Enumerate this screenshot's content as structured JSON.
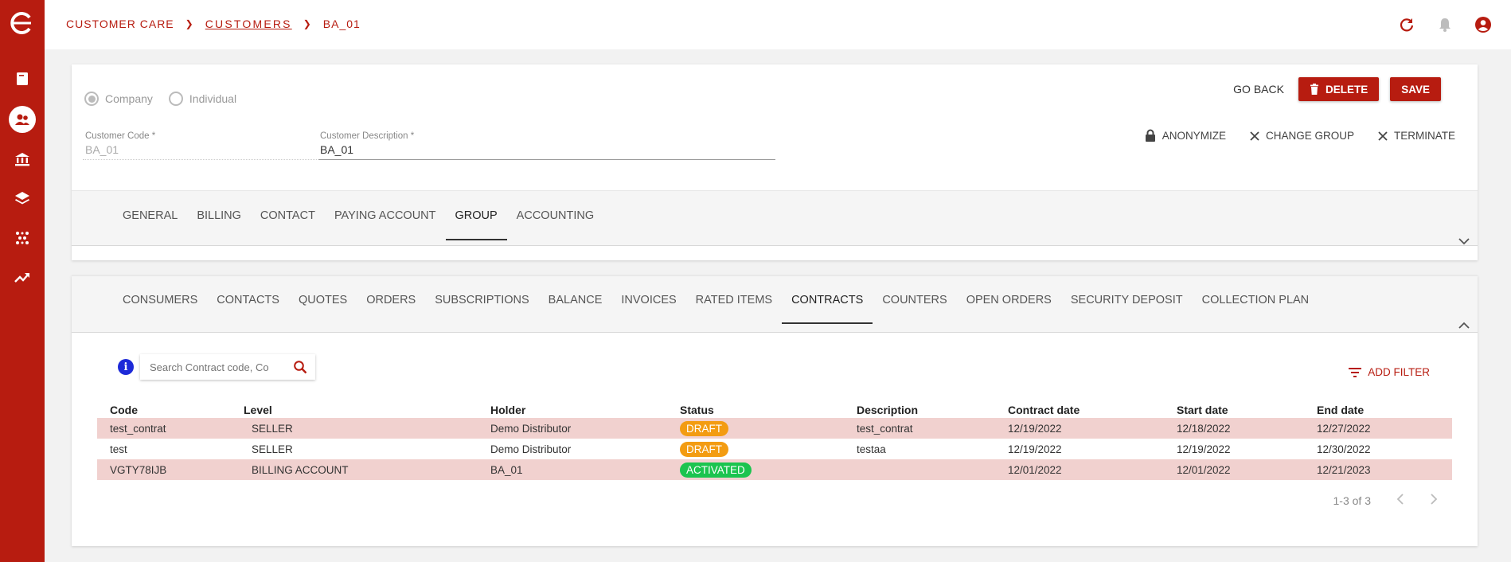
{
  "colors": {
    "accent": "#b71c10",
    "draft": "#f39c12",
    "activated": "#1bc44f",
    "row_highlight": "#f1d1cf"
  },
  "breadcrumb": {
    "root": "CUSTOMER CARE",
    "customers": "CUSTOMERS",
    "current": "BA_01"
  },
  "top_icons": [
    "refresh-icon",
    "bell-icon",
    "account-circle-icon"
  ],
  "sidebar": [
    "logo-icon",
    "book-icon",
    "users-icon",
    "bank-icon",
    "layers-icon",
    "network-icon",
    "trending-up-icon"
  ],
  "customer": {
    "type_company": "Company",
    "type_individual": "Individual",
    "code_label": "Customer Code *",
    "code_value": "BA_01",
    "desc_label": "Customer Description *",
    "desc_value": "BA_01"
  },
  "actions": {
    "go_back": "GO BACK",
    "delete": "DELETE",
    "save": "SAVE",
    "anonymize": "ANONYMIZE",
    "change_group": "CHANGE GROUP",
    "terminate": "TERMINATE"
  },
  "tabs_top": [
    "GENERAL",
    "BILLING",
    "CONTACT",
    "PAYING ACCOUNT",
    "GROUP",
    "ACCOUNTING"
  ],
  "tabs_top_active": "GROUP",
  "tabs_bottom": [
    "CONSUMERS",
    "CONTACTS",
    "QUOTES",
    "ORDERS",
    "SUBSCRIPTIONS",
    "BALANCE",
    "INVOICES",
    "RATED ITEMS",
    "CONTRACTS",
    "COUNTERS",
    "OPEN ORDERS",
    "SECURITY DEPOSIT",
    "COLLECTION PLAN"
  ],
  "tabs_bottom_active": "CONTRACTS",
  "search": {
    "placeholder": "Search Contract code, Co"
  },
  "filter": {
    "add_label": "ADD FILTER"
  },
  "table": {
    "columns": [
      "Code",
      "Level",
      "Holder",
      "Status",
      "Description",
      "Contract date",
      "Start date",
      "End date"
    ],
    "rows": [
      {
        "code": "test_contrat",
        "level": "SELLER",
        "holder": "Demo Distributor",
        "status": "DRAFT",
        "description": "test_contrat",
        "contract_date": "12/19/2022",
        "start_date": "12/18/2022",
        "end_date": "12/27/2022",
        "highlight": true
      },
      {
        "code": "test",
        "level": "SELLER",
        "holder": "Demo Distributor",
        "status": "DRAFT",
        "description": "testaa",
        "contract_date": "12/19/2022",
        "start_date": "12/19/2022",
        "end_date": "12/30/2022",
        "highlight": false
      },
      {
        "code": "VGTY78IJB",
        "level": "BILLING ACCOUNT",
        "holder": "BA_01",
        "status": "ACTIVATED",
        "description": "",
        "contract_date": "12/01/2022",
        "start_date": "12/01/2022",
        "end_date": "12/21/2023",
        "highlight": true
      }
    ]
  },
  "pager": {
    "range": "1-3 of 3"
  }
}
